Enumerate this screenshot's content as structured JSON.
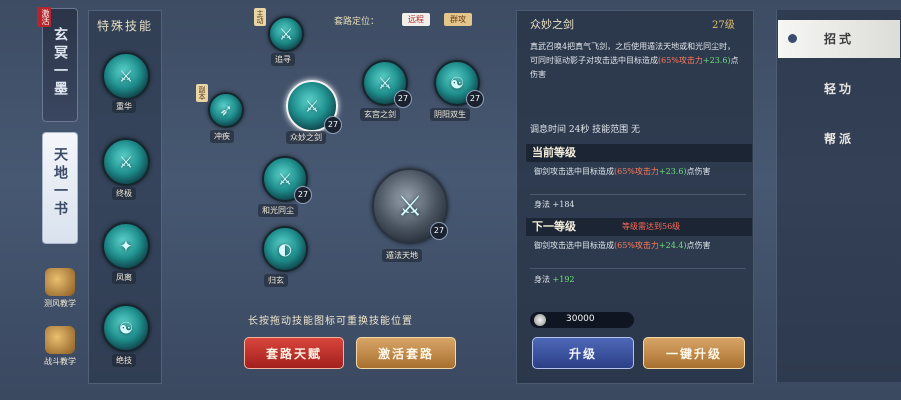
{
  "left_tabs": {
    "scroll1_cap": "激活",
    "scroll1": "玄冥一墨",
    "scroll2": "天地一书",
    "teach1": "测风教学",
    "teach2": "战斗教学"
  },
  "special": {
    "header": "特殊技能",
    "skills": [
      "重华",
      "终极",
      "凤离",
      "绝技"
    ]
  },
  "tree": {
    "routine_label": "套路定位：",
    "chip1": "远程",
    "chip2": "群攻",
    "tag_main": "主动",
    "tag_side": "副本",
    "skills": [
      {
        "name": "追寻"
      },
      {
        "name": "冲疾"
      },
      {
        "name": "众妙之剑",
        "level": "27"
      },
      {
        "name": "玄宫之剑",
        "level": "27"
      },
      {
        "name": "阴阳双生",
        "level": "27"
      },
      {
        "name": "和光同尘",
        "level": "27"
      },
      {
        "name": "遁法天地",
        "level": "27"
      },
      {
        "name": "归玄"
      }
    ],
    "hint": "长按拖动技能图标可重换技能位置",
    "btn_talent": "套路天赋",
    "btn_activate": "激活套路"
  },
  "detail": {
    "title": "众妙之剑",
    "level": "27级",
    "desc_a": "真武召唤4把真气飞剑，之后使用遁法天地或和光同尘时，可同时驱动影子对攻击选中目标造成",
    "desc_hl": "(65%攻击力",
    "desc_gn": "+23.6)",
    "desc_b": "点伤害",
    "cooldown": "调息时间 24秒   技能范围 无",
    "cur_head": "当前等级",
    "cur_line1a": "御剑攻击选中目标造成",
    "cur_line1hl": "(65%攻击力",
    "cur_line1gn": "+23.6)",
    "cur_line1b": "点伤害",
    "cur_line2": "身法 +184",
    "next_head": "下一等级",
    "next_req": "等级需达到56级",
    "next_line1a": "御剑攻击选中目标造成",
    "next_line1hl": "(65%攻击力",
    "next_line1gn": "+24.4)",
    "next_line1b": "点伤害",
    "next_line2a": "身法",
    "next_line2gn": "+192",
    "coins": "30000",
    "btn_up": "升级",
    "btn_oneclick": "一键升级"
  },
  "right_tabs": [
    "招式",
    "轻功",
    "帮派"
  ]
}
